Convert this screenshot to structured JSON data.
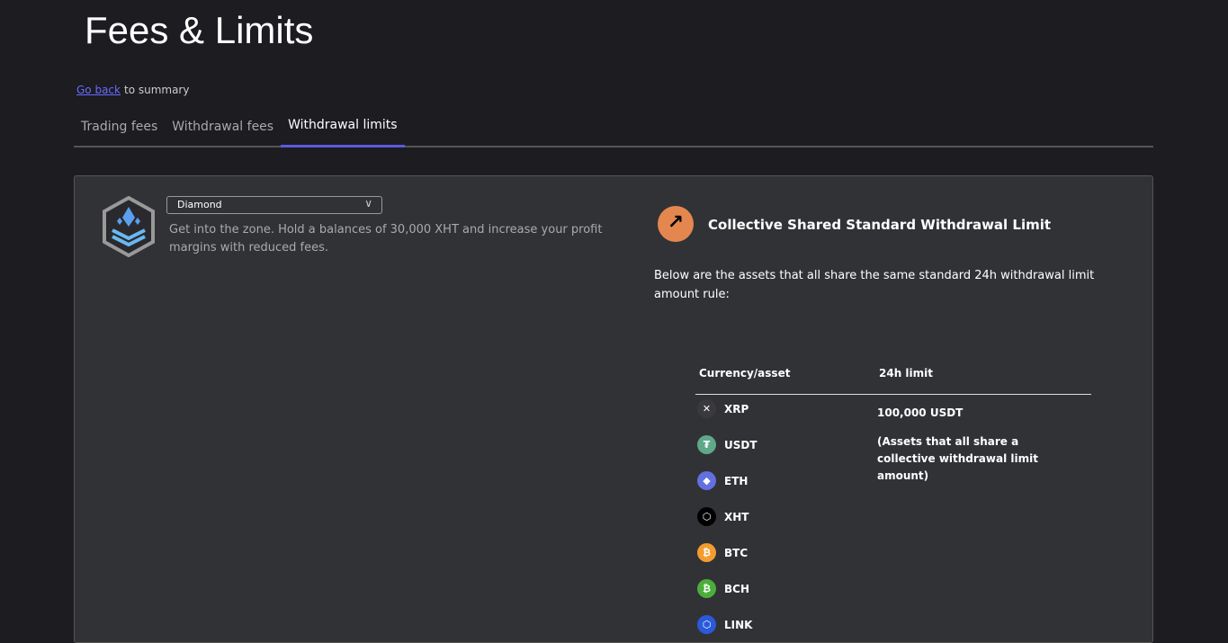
{
  "page_title": "Fees & Limits",
  "back": {
    "link": "Go back",
    "suffix": "to summary"
  },
  "tabs": [
    {
      "label": "Trading fees"
    },
    {
      "label": "Withdrawal fees"
    },
    {
      "label": "Withdrawal limits",
      "active": true
    }
  ],
  "tier": {
    "selected": "Diamond",
    "description": "Get into the zone. Hold a balances of 30,000 XHT and increase your profit margins with reduced fees."
  },
  "limit_section": {
    "title": "Collective Shared Standard Withdrawal Limit",
    "intro": "Below are the assets that all share the same standard 24h withdrawal limit amount rule:",
    "columns": [
      "Currency/asset",
      "24h limit"
    ],
    "limit": "100,000 USDT",
    "note": "(Assets that all share a collective withdrawal limit amount)",
    "assets": [
      {
        "symbol": "XRP",
        "color": "#3a3a3e"
      },
      {
        "symbol": "USDT",
        "color": "#5fa88a"
      },
      {
        "symbol": "ETH",
        "color": "#6270e0"
      },
      {
        "symbol": "XHT",
        "color": "#000000"
      },
      {
        "symbol": "BTC",
        "color": "#f39c2f"
      },
      {
        "symbol": "BCH",
        "color": "#4cae3a"
      },
      {
        "symbol": "LINK",
        "color": "#2a5ada"
      }
    ]
  },
  "colors": {
    "accent": "#5b5bdc",
    "arrow": "#e4874f"
  }
}
